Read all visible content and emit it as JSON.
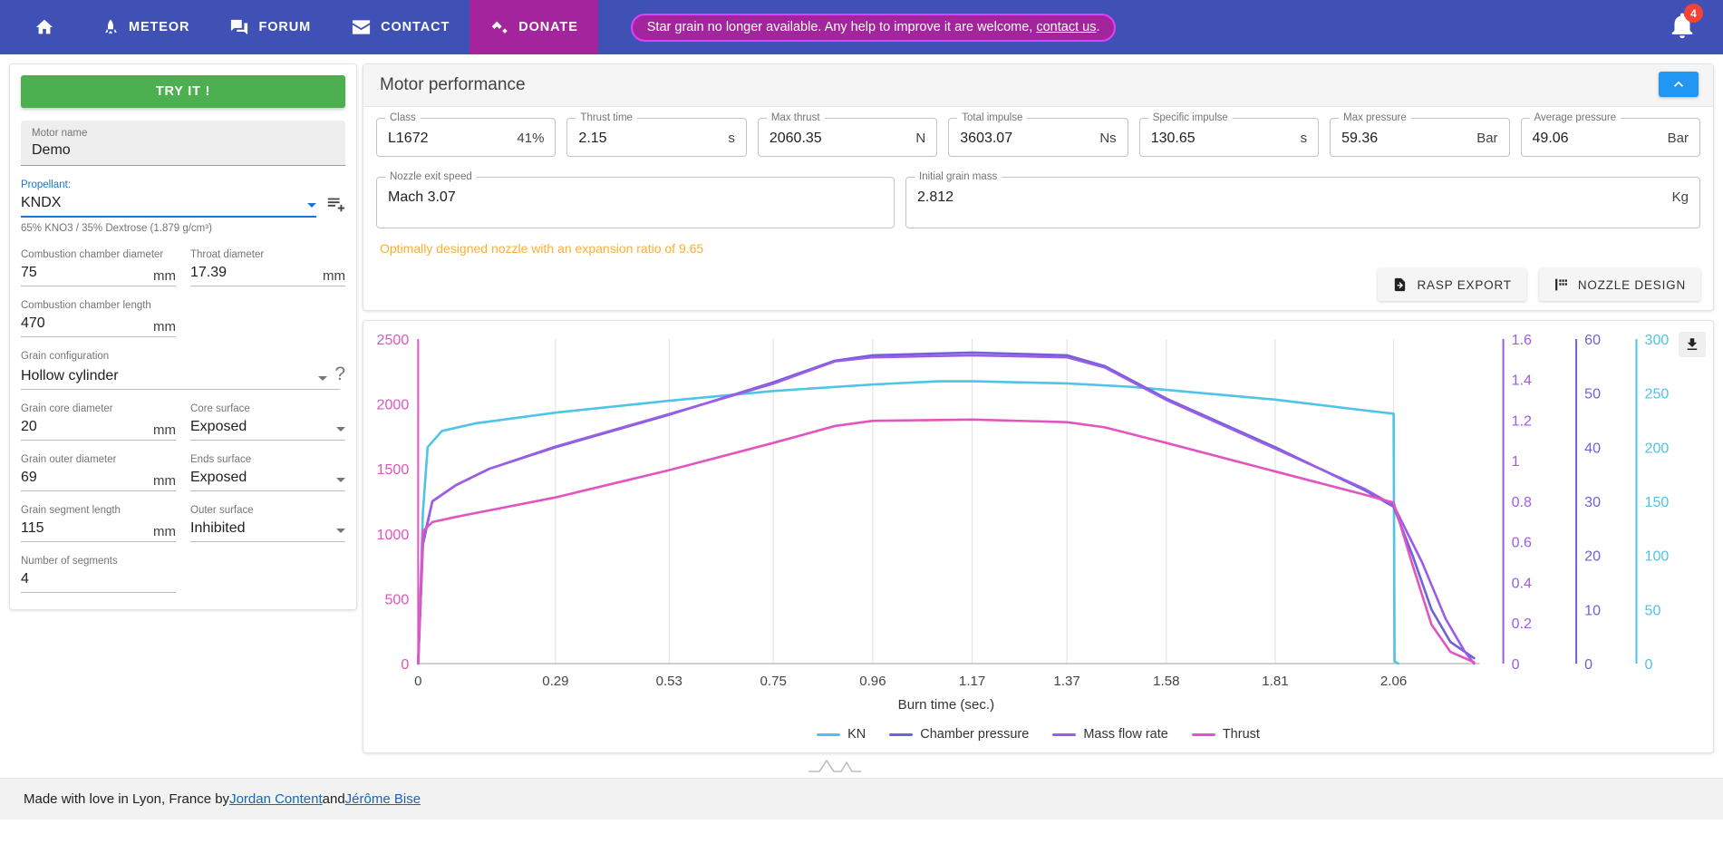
{
  "nav": {
    "items": [
      {
        "label": "",
        "icon": "home-icon",
        "name": "nav-home"
      },
      {
        "label": "METEOR",
        "icon": "rocket-icon",
        "name": "nav-meteor"
      },
      {
        "label": "FORUM",
        "icon": "forum-icon",
        "name": "nav-forum"
      },
      {
        "label": "CONTACT",
        "icon": "mail-icon",
        "name": "nav-contact"
      },
      {
        "label": "DONATE",
        "icon": "donate-icon",
        "name": "nav-donate"
      }
    ],
    "banner_text": "Star grain no longer available. Any help to improve it are welcome,",
    "banner_link": "contact us",
    "banner_end": ".",
    "notification_count": "4",
    "bar_color": "#3f51b5",
    "donate_color": "#a4249e"
  },
  "sidebar": {
    "try_it_label": "TRY IT !",
    "motor_name_label": "Motor name",
    "motor_name_value": "Demo",
    "propellant_label": "Propellant:",
    "propellant_value": "KNDX",
    "propellant_hint": "65% KNO3 / 35% Dextrose (1.879 g/cm³)",
    "fields": [
      {
        "label": "Combustion chamber diameter",
        "value": "75",
        "unit": "mm"
      },
      {
        "label": "Throat diameter",
        "value": "17.39",
        "unit": "mm"
      },
      {
        "label": "Combustion chamber length",
        "value": "470",
        "unit": "mm"
      },
      {
        "label": "Grain configuration",
        "value": "Hollow cylinder",
        "unit": ""
      },
      {
        "label": "Grain core diameter",
        "value": "20",
        "unit": "mm"
      },
      {
        "label": "Core surface",
        "value": "Exposed",
        "unit": ""
      },
      {
        "label": "Grain outer diameter",
        "value": "69",
        "unit": "mm"
      },
      {
        "label": "Ends surface",
        "value": "Exposed",
        "unit": ""
      },
      {
        "label": "Grain segment length",
        "value": "115",
        "unit": "mm"
      },
      {
        "label": "Outer surface",
        "value": "Inhibited",
        "unit": ""
      },
      {
        "label": "Number of segments",
        "value": "4",
        "unit": ""
      }
    ],
    "help_glyph": "?"
  },
  "performance": {
    "title": "Motor performance",
    "metrics": [
      {
        "label": "Class",
        "value": "L1672",
        "unit": "41%"
      },
      {
        "label": "Thrust time",
        "value": "2.15",
        "unit": "s"
      },
      {
        "label": "Max thrust",
        "value": "2060.35",
        "unit": "N"
      },
      {
        "label": "Total impulse",
        "value": "3603.07",
        "unit": "Ns"
      },
      {
        "label": "Specific impulse",
        "value": "130.65",
        "unit": "s"
      },
      {
        "label": "Max pressure",
        "value": "59.36",
        "unit": "Bar"
      },
      {
        "label": "Average pressure",
        "value": "49.06",
        "unit": "Bar"
      }
    ],
    "metrics_row2": [
      {
        "label": "Nozzle exit speed",
        "value": "Mach 3.07",
        "unit": ""
      },
      {
        "label": "Initial grain mass",
        "value": "2.812",
        "unit": "Kg"
      }
    ],
    "note": "Optimally designed nozzle with an expansion ratio of 9.65",
    "rasp_export_label": "RASP EXPORT",
    "nozzle_design_label": "NOZZLE DESIGN"
  },
  "chart_data": {
    "type": "line",
    "title": "",
    "xlabel": "Burn time (sec.)",
    "x_ticks": [
      "0",
      "0.29",
      "0.53",
      "0.75",
      "0.96",
      "1.17",
      "1.37",
      "1.58",
      "1.81",
      "2.06"
    ],
    "xlim": [
      0,
      2.23
    ],
    "axes": [
      {
        "name": "Thrust",
        "side": "left",
        "color": "#e255c0",
        "ticks": [
          0,
          500,
          1000,
          1500,
          2000,
          2500
        ],
        "lim": [
          0,
          2500
        ]
      },
      {
        "name": "Mass flow rate",
        "side": "right",
        "color": "#9b5de5",
        "ticks": [
          0,
          0.2,
          0.4,
          0.6,
          0.8,
          1,
          1.2,
          1.4,
          1.6
        ],
        "lim": [
          0,
          1.6
        ]
      },
      {
        "name": "Chamber pressure",
        "side": "right",
        "color": "#6c63d8",
        "ticks": [
          0,
          10,
          20,
          30,
          40,
          50,
          60
        ],
        "lim": [
          0,
          60
        ]
      },
      {
        "name": "KN",
        "side": "right",
        "color": "#4fc3e8",
        "ticks": [
          0,
          50,
          100,
          150,
          200,
          250,
          300
        ],
        "lim": [
          0,
          300
        ]
      }
    ],
    "legend": [
      {
        "label": "KN",
        "color": "#4fc3e8"
      },
      {
        "label": "Chamber pressure",
        "color": "#6c63d8"
      },
      {
        "label": "Mass flow rate",
        "color": "#9b5de5"
      },
      {
        "label": "Thrust",
        "color": "#e255c0"
      }
    ],
    "legend_position": "bottom",
    "grid": "vertical",
    "series": [
      {
        "name": "KN",
        "color": "#4fc3e8",
        "axis": "KN",
        "x": [
          0,
          0.01,
          0.02,
          0.05,
          0.12,
          0.29,
          0.53,
          0.75,
          0.96,
          1.1,
          1.17,
          1.37,
          1.5,
          1.58,
          1.81,
          2.0,
          2.06,
          2.062,
          2.07
        ],
        "y": [
          0,
          140,
          200,
          215,
          222,
          232,
          243,
          252,
          258,
          261,
          261,
          259,
          256,
          253,
          244,
          234,
          231,
          2,
          0
        ]
      },
      {
        "name": "Chamber pressure",
        "color": "#6c63d8",
        "axis": "Chamber pressure",
        "x": [
          0,
          0.01,
          0.03,
          0.08,
          0.15,
          0.29,
          0.53,
          0.75,
          0.88,
          0.96,
          1.17,
          1.37,
          1.45,
          1.58,
          1.81,
          2.0,
          2.06,
          2.1,
          2.14,
          2.18,
          2.23
        ],
        "y": [
          0,
          22,
          30,
          33,
          36,
          40,
          46,
          52,
          56,
          57,
          57.5,
          57,
          55,
          49,
          40,
          32,
          29,
          20,
          10,
          4,
          1
        ]
      },
      {
        "name": "Mass flow rate",
        "color": "#9b5de5",
        "axis": "Mass flow rate",
        "x": [
          0,
          0.01,
          0.03,
          0.08,
          0.15,
          0.29,
          0.53,
          0.75,
          0.88,
          0.96,
          1.17,
          1.37,
          1.45,
          1.58,
          1.81,
          2.0,
          2.06,
          2.12,
          2.17,
          2.21,
          2.23
        ],
        "y": [
          0,
          0.6,
          0.8,
          0.88,
          0.96,
          1.07,
          1.23,
          1.38,
          1.49,
          1.51,
          1.52,
          1.51,
          1.46,
          1.3,
          1.06,
          0.86,
          0.78,
          0.5,
          0.22,
          0.06,
          0.0
        ]
      },
      {
        "name": "Thrust",
        "color": "#e255c0",
        "axis": "Thrust",
        "x": [
          0,
          0.01,
          0.03,
          0.08,
          0.15,
          0.29,
          0.53,
          0.75,
          0.88,
          0.96,
          1.17,
          1.37,
          1.45,
          1.58,
          1.81,
          2.0,
          2.06,
          2.1,
          2.14,
          2.18,
          2.23
        ],
        "y": [
          0,
          1020,
          1090,
          1130,
          1180,
          1280,
          1490,
          1700,
          1830,
          1870,
          1880,
          1860,
          1820,
          1700,
          1480,
          1300,
          1240,
          760,
          300,
          90,
          10
        ]
      }
    ]
  },
  "footer": {
    "text_before": "Made with love in Lyon, France by ",
    "link1": "Jordan Content",
    "text_mid": " and ",
    "link2": "Jérôme Bise"
  }
}
